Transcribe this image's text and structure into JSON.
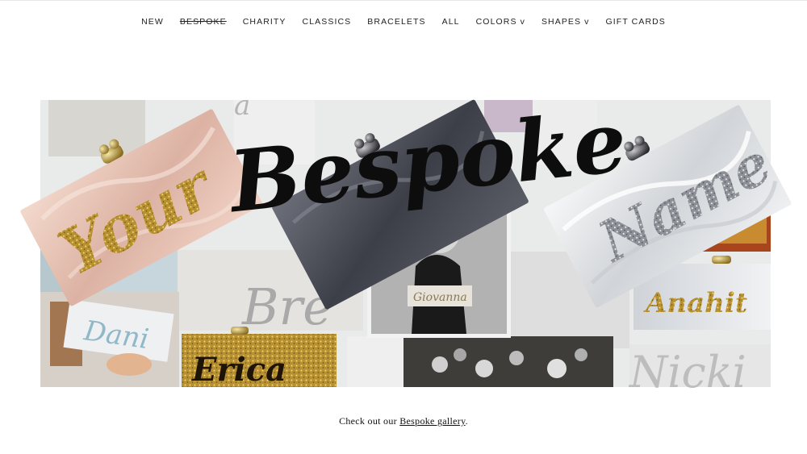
{
  "nav": {
    "items": [
      {
        "label": "NEW",
        "active": false
      },
      {
        "label": "BESPOKE",
        "active": true
      },
      {
        "label": "CHARITY",
        "active": false
      },
      {
        "label": "CLASSICS",
        "active": false
      },
      {
        "label": "BRACELETS",
        "active": false
      },
      {
        "label": "ALL",
        "active": false
      },
      {
        "label": "COLORS v",
        "active": false
      },
      {
        "label": "SHAPES v",
        "active": false
      },
      {
        "label": "GIFT CARDS",
        "active": false
      }
    ]
  },
  "hero": {
    "headline_words": [
      "Your",
      "Bespoke",
      "Name"
    ],
    "collage_names": [
      "Dani",
      "Erica",
      "Bre",
      "Anahit",
      "Nicki",
      "Giovanna"
    ]
  },
  "caption": {
    "prefix": "Check out our ",
    "link_text": "Bespoke gallery",
    "suffix": "."
  },
  "colors": {
    "pink_clutch": "#e9c7b9",
    "grey_clutch": "#5a5c66",
    "white_clutch": "#e7e8ea",
    "glitter_gold": "#b7902f",
    "script_ink": "#0d0d0d"
  }
}
